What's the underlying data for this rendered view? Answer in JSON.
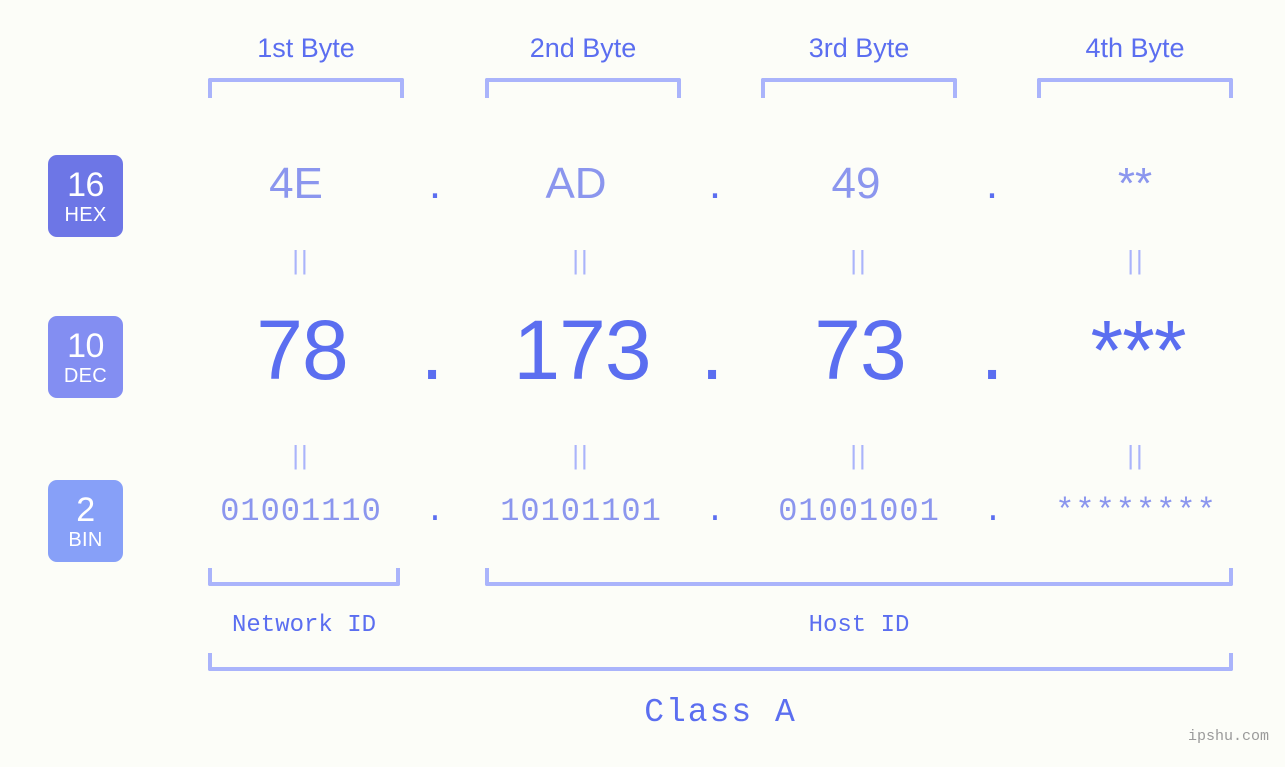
{
  "background_color": "#fcfdf8",
  "accent_color": "#5b6ef0",
  "muted_accent_color": "#8b96ee",
  "bracket_color": "#aab4fb",
  "byte_headers": [
    {
      "label": "1st Byte"
    },
    {
      "label": "2nd Byte"
    },
    {
      "label": "3rd Byte"
    },
    {
      "label": "4th Byte"
    }
  ],
  "bases": [
    {
      "number": "16",
      "abbr": "HEX",
      "color": "#6d76e6"
    },
    {
      "number": "10",
      "abbr": "DEC",
      "color": "#838ef2"
    },
    {
      "number": "2",
      "abbr": "BIN",
      "color": "#87a0f8"
    }
  ],
  "rows": {
    "hex": {
      "base_number": "16",
      "base_abbr": "HEX",
      "octets": [
        "4E",
        "AD",
        "49",
        "**"
      ],
      "separator": "."
    },
    "dec": {
      "base_number": "10",
      "base_abbr": "DEC",
      "octets": [
        "78",
        "173",
        "73",
        "***"
      ],
      "separator": "."
    },
    "bin": {
      "base_number": "2",
      "base_abbr": "BIN",
      "octets": [
        "01001110",
        "10101101",
        "01001001",
        "********"
      ],
      "separator": "."
    }
  },
  "equality_marks": {
    "glyph": "||",
    "count_per_row": 4
  },
  "segments": {
    "network_id": "Network ID",
    "host_id": "Host ID",
    "class": "Class A"
  },
  "watermark": "ipshu.com"
}
